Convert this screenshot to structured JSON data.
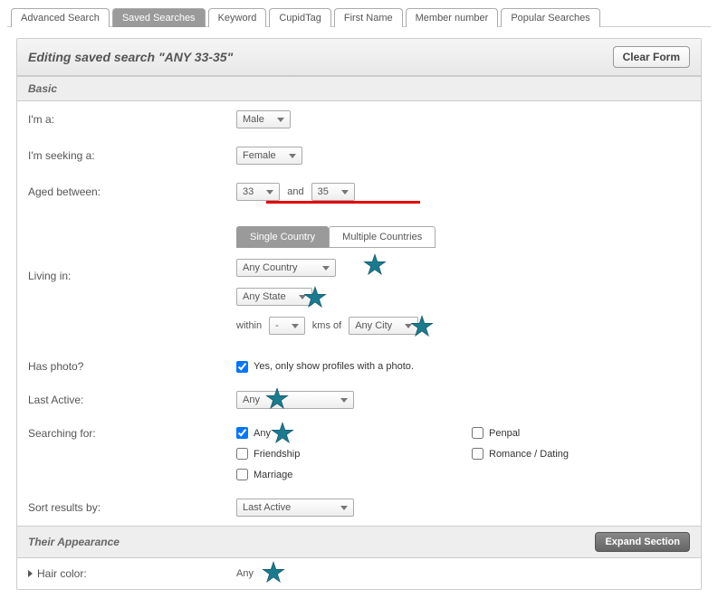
{
  "tabs": {
    "advanced": "Advanced Search",
    "saved": "Saved Searches",
    "keyword": "Keyword",
    "cupidtag": "CupidTag",
    "firstname": "First Name",
    "member": "Member number",
    "popular": "Popular Searches"
  },
  "header": {
    "title": "Editing saved search \"ANY 33-35\"",
    "clear": "Clear Form"
  },
  "sections": {
    "basic": "Basic",
    "appearance": "Their Appearance",
    "expand": "Expand Section"
  },
  "labels": {
    "ima": "I'm a:",
    "seeking": "I'm seeking a:",
    "aged": "Aged between:",
    "and": "and",
    "living": "Living in:",
    "within": "within",
    "kms_of": "kms   of",
    "hasphoto": "Has photo?",
    "photoText": "Yes, only show profiles with a photo.",
    "lastactive": "Last Active:",
    "searchingfor": "Searching for:",
    "sortby": "Sort results by:",
    "haircolor": "Hair color:"
  },
  "subtabs": {
    "single": "Single Country",
    "multiple": "Multiple Countries"
  },
  "values": {
    "gender": "Male",
    "seeking": "Female",
    "ageFrom": "33",
    "ageTo": "35",
    "country": "Any Country",
    "state": "Any State",
    "distance": "-",
    "city": "Any City",
    "lastActive": "Any",
    "sortBy": "Last Active",
    "hairColor": "Any"
  },
  "searchFor": {
    "any": "Any",
    "penpal": "Penpal",
    "friendship": "Friendship",
    "romance": "Romance / Dating",
    "marriage": "Marriage"
  }
}
